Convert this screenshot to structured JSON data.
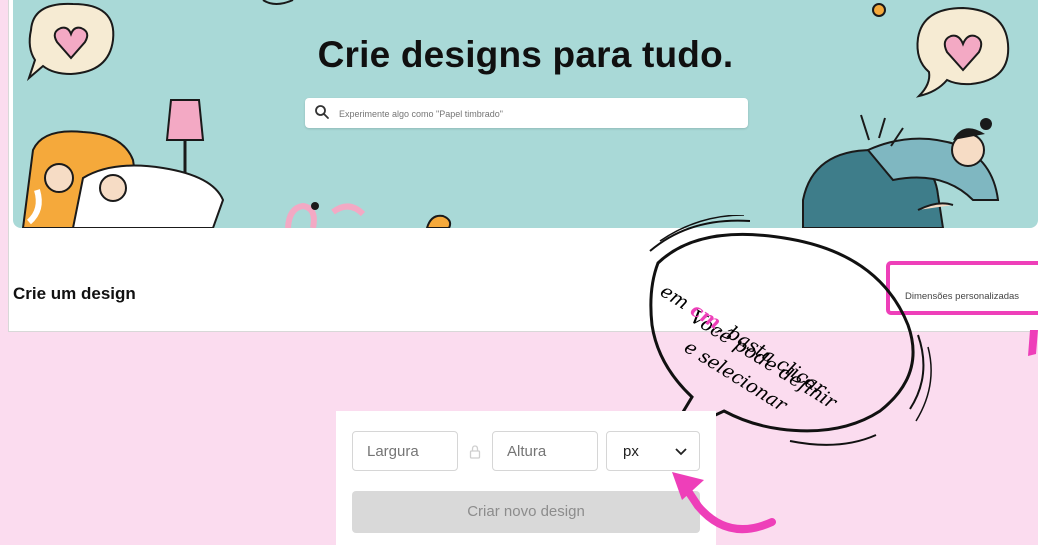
{
  "hero": {
    "title": "Crie designs para tudo.",
    "search_placeholder": "Experimente algo como \"Papel timbrado\""
  },
  "section": {
    "title": "Crie um design"
  },
  "custom_dimensions": {
    "label": "Dimensões personalizadas",
    "highlight_color": "#ee3fb9"
  },
  "form": {
    "width_placeholder": "Largura",
    "height_placeholder": "Altura",
    "unit_value": "px",
    "create_label": "Criar novo design"
  },
  "annotation": {
    "line1": "Você pode definir",
    "line2_a": "em ",
    "line2_em": "cm",
    "line2_b": ", basta clicar",
    "line3": "e selecionar",
    "accent_color": "#ee3fb9"
  },
  "colors": {
    "page_bg": "#fbdcef",
    "hero_bg": "#a9d9d7"
  },
  "icons": [
    "search-icon",
    "lock-icon",
    "chevron-down-icon",
    "heart-bubble-icon",
    "arrow-icon"
  ]
}
